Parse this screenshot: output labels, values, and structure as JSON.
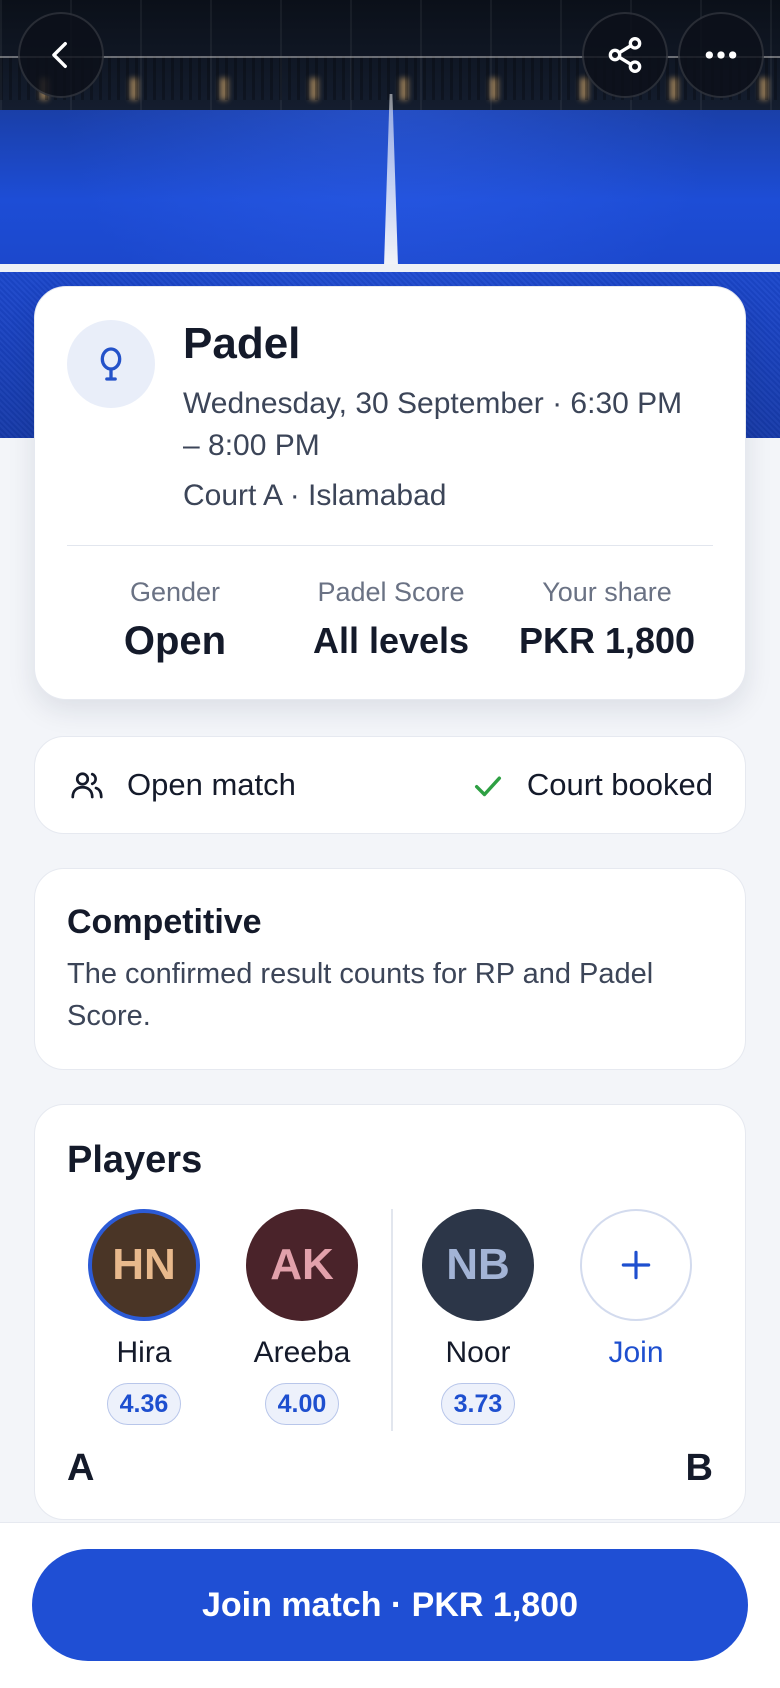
{
  "hero": {
    "back_icon": "chevron-left-icon",
    "share_icon": "share-icon",
    "more_icon": "more-horizontal-icon"
  },
  "match": {
    "sport": "Padel",
    "sport_icon": "padel-racket-icon",
    "datetime": "Wednesday, 30 September · 6:30 PM – 8:00 PM",
    "location": "Court A · Islamabad",
    "stats": [
      {
        "label": "Gender",
        "value": "Open"
      },
      {
        "label": "Padel Score",
        "value": "All levels"
      },
      {
        "label": "Your share",
        "value": "PKR 1,800"
      }
    ]
  },
  "status": {
    "type_label": "Open match",
    "type_icon": "people-icon",
    "booking_label": "Court booked",
    "booking_icon": "check-icon",
    "check_color": "#2ea043"
  },
  "competitive": {
    "title": "Competitive",
    "description": "The confirmed result counts for RP and Padel Score."
  },
  "players": {
    "title": "Players",
    "list": [
      {
        "initials": "HN",
        "name": "Hira",
        "score": "4.36"
      },
      {
        "initials": "AK",
        "name": "Areeba",
        "score": "4.00"
      },
      {
        "initials": "NB",
        "name": "Noor",
        "score": "3.73"
      }
    ],
    "join_label": "Join",
    "join_icon": "plus-icon",
    "team_a": "A",
    "team_b": "B"
  },
  "cta": {
    "label": "Join match · PKR 1,800",
    "color": "#1f4fd4"
  }
}
